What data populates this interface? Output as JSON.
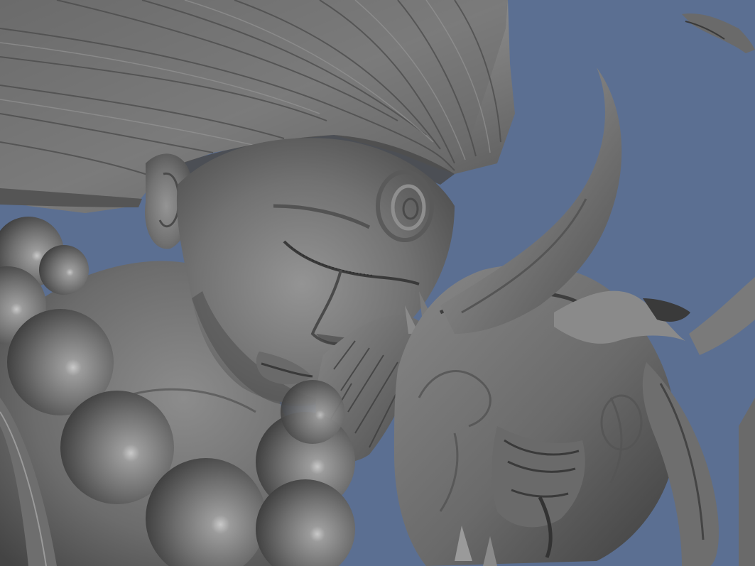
{
  "viewport": {
    "background_color": "#5b6f92",
    "material_color": "#7a7a7a",
    "subject": "sculpt-render"
  },
  "palette": {
    "highlight": "#c9c9c9",
    "light": "#a6a6a6",
    "mid": "#7e7e7e",
    "shade": "#5a5a5a",
    "deep": "#3a3a3a"
  }
}
